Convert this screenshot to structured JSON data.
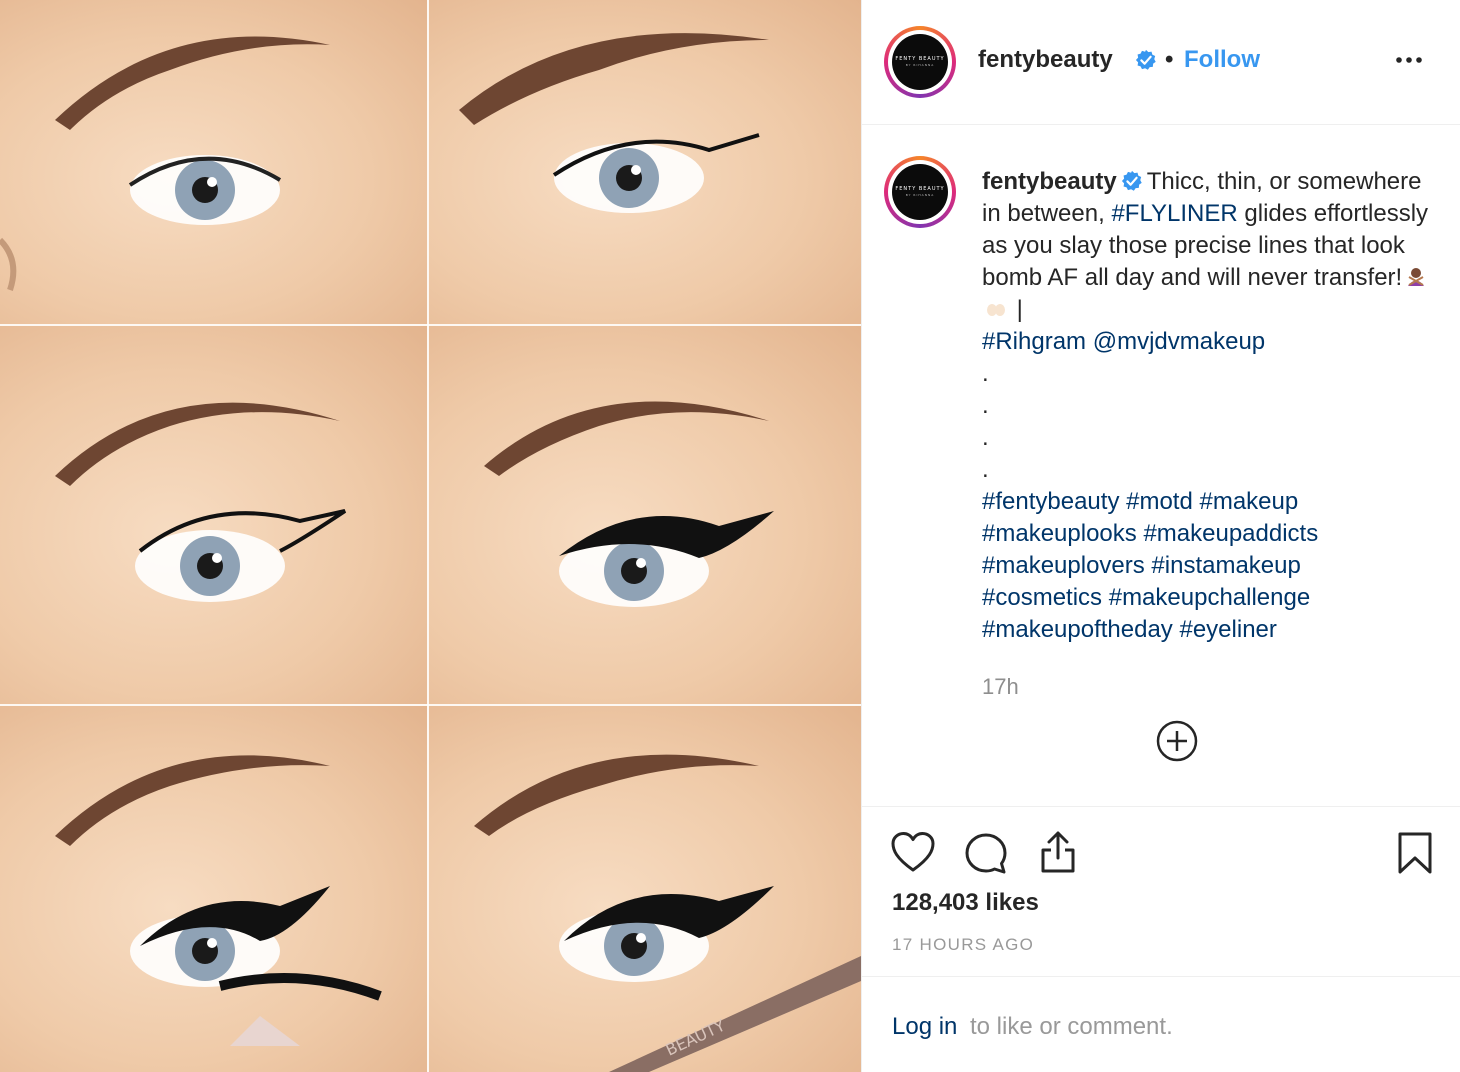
{
  "post": {
    "username": "fentybeauty",
    "follow_label": "Follow",
    "separator": "•",
    "avatar_logo_text": "FENTY BEAUTY",
    "avatar_logo_sub": "BY RIHANNA",
    "photo_brand_text": "BEAUTY"
  },
  "caption": {
    "username": "fentybeauty",
    "text_1": "Thicc, thin, or somewhere in between,",
    "hashtag_flyliner": "#FLYLINER",
    "text_2": "glides effortlessly as you slay those precise lines that look bomb AF all day and will never transfer!",
    "pipe": "|",
    "hashtag_rihgram": "#Rihgram",
    "mention": "@mvjdvmakeup",
    "dots": [
      ".",
      ".",
      ".",
      "."
    ],
    "hashtags": [
      "#fentybeauty",
      "#motd",
      "#makeup",
      "#makeuplooks",
      "#makeupaddicts",
      "#makeuplovers",
      "#instamakeup",
      "#cosmetics",
      "#makeupchallenge",
      "#makeupoftheday",
      "#eyeliner"
    ],
    "time": "17h"
  },
  "icons": {
    "verified": "verified-badge-icon",
    "more": "more-options-icon",
    "emoji_1": "person-gesturing-no-emoji",
    "emoji_2": "raising-hands-emoji",
    "load_more": "plus-circle-icon",
    "like": "heart-icon",
    "comment": "comment-icon",
    "share": "share-icon",
    "save": "bookmark-icon"
  },
  "stats": {
    "likes": "128,403 likes",
    "posted_ago": "17 HOURS AGO"
  },
  "login": {
    "link_label": "Log in",
    "rest_text": "to like or comment."
  },
  "colors": {
    "link_blue": "#3897f0",
    "hashtag_blue": "#003569",
    "muted_gray": "#8e8e8e",
    "skin_tone": "#efcaa8"
  }
}
